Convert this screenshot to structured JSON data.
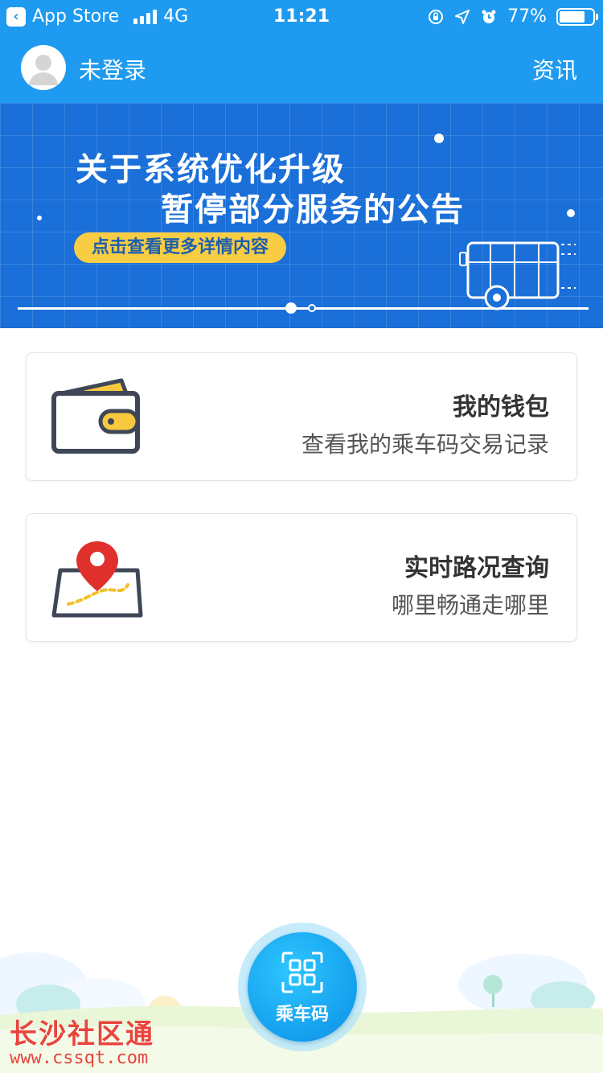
{
  "status_bar": {
    "back_app": "App Store",
    "network": "4G",
    "time": "11:21",
    "battery": "77%",
    "battery_fraction": 0.77
  },
  "header": {
    "user_status": "未登录",
    "news_label": "资讯"
  },
  "banner": {
    "title_line1": "关于系统优化升级",
    "title_line2": "暂停部分服务的公告",
    "cta": "点击查看更多详情内容"
  },
  "cards": [
    {
      "title": "我的钱包",
      "subtitle": "查看我的乘车码交易记录",
      "icon": "wallet-icon"
    },
    {
      "title": "实时路况查询",
      "subtitle": "哪里畅通走哪里",
      "icon": "map-pin-icon"
    }
  ],
  "ride_code": {
    "label": "乘车码",
    "icon": "qr-scan-icon"
  },
  "watermark": {
    "name": "长沙社区通",
    "url": "www.cssqt.com"
  },
  "colors": {
    "primary": "#1e9bf0",
    "banner": "#1a6fd8",
    "accent_yellow": "#f8cc43",
    "pin_red": "#e0302c"
  }
}
